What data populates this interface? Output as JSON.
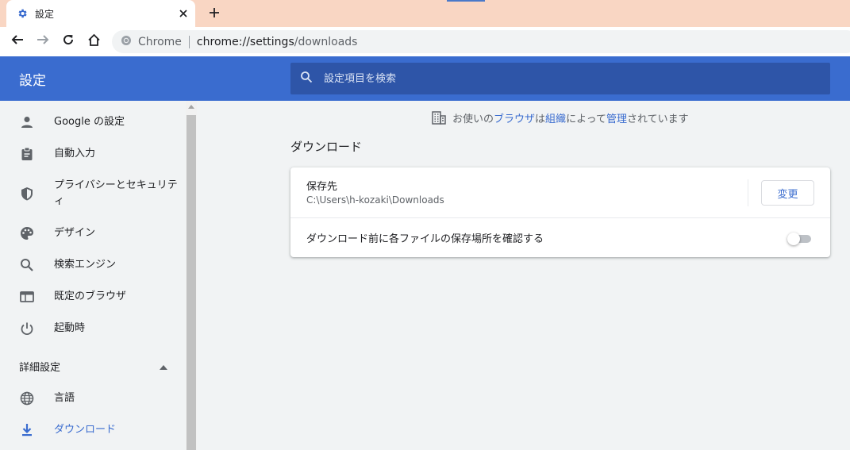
{
  "tab": {
    "title": "設定",
    "favicon": "gear-icon",
    "close": "close-icon",
    "new_tab": "plus-icon"
  },
  "toolbar": {
    "back": "arrow-left-icon",
    "forward": "arrow-right-icon",
    "reload": "reload-icon",
    "home": "home-icon",
    "site_chip": "Chrome",
    "url_host": "chrome://settings",
    "url_path": "/downloads"
  },
  "header": {
    "title": "設定",
    "search_placeholder": "設定項目を検索"
  },
  "sidebar": {
    "items": [
      {
        "label": "Google の設定",
        "icon": "person-icon"
      },
      {
        "label": "自動入力",
        "icon": "clipboard-icon"
      },
      {
        "label": "プライバシーとセキュリティ",
        "icon": "shield-icon"
      },
      {
        "label": "デザイン",
        "icon": "palette-icon"
      },
      {
        "label": "検索エンジン",
        "icon": "search-icon"
      },
      {
        "label": "既定のブラウザ",
        "icon": "browser-window-icon"
      },
      {
        "label": "起動時",
        "icon": "power-icon"
      }
    ],
    "advanced_label": "詳細設定",
    "advanced_items": [
      {
        "label": "言語",
        "icon": "globe-icon"
      },
      {
        "label": "ダウンロード",
        "icon": "download-icon",
        "active": true
      }
    ]
  },
  "main": {
    "managed_notice": {
      "prefix": "お使いの",
      "link1": "ブラウザ",
      "middle1": "は",
      "link2": "組織",
      "middle2": "によって",
      "link3": "管理",
      "suffix": "されています"
    },
    "section_title": "ダウンロード",
    "location_label": "保存先",
    "location_path": "C:\\Users\\h-kozaki\\Downloads",
    "change_button": "変更",
    "ask_label": "ダウンロード前に各ファイルの保存場所を確認する",
    "ask_enabled": false
  },
  "colors": {
    "accent": "#3a6ccf",
    "header_bg": "#3a6ccf",
    "search_bg": "#2e55a8",
    "tabstrip_bg": "#f9d6c3"
  }
}
